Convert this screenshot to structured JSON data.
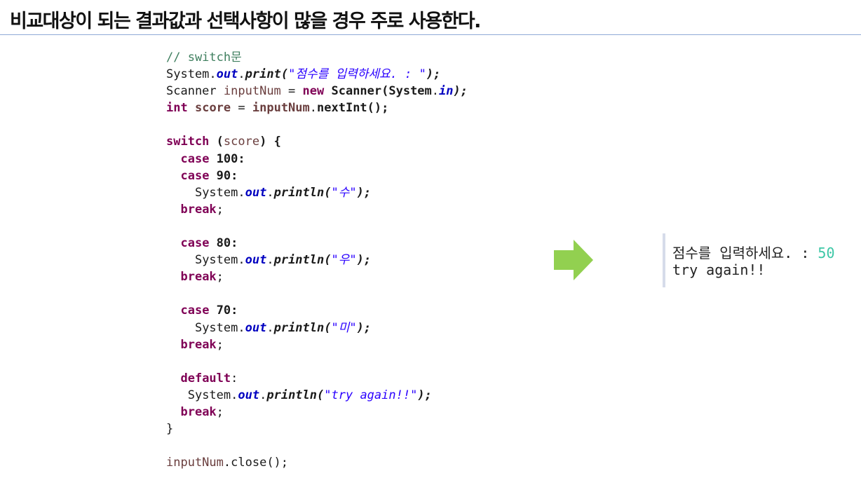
{
  "heading": "비교대상이 되는 결과값과 선택사항이 많을 경우 주로 사용한다.",
  "code": {
    "comment": "// switch문",
    "l2": {
      "cls": "System",
      "dot": ".",
      "fld": "out",
      "dot2": ".",
      "mth": "print",
      "open": "(",
      "str": "\"점수를 입력하세요. : \"",
      "close": ");"
    },
    "l3": {
      "type": "Scanner",
      "var": "inputNum",
      "eq": " = ",
      "kw": "new",
      "ctor": "Scanner(System",
      "dot": ".",
      "fld": "in",
      "close": ");"
    },
    "l4": {
      "kw": "int",
      "var": "score",
      "eq": " = ",
      "var2": "inputNum",
      "dot": ".",
      "call": "nextInt();"
    },
    "l6": {
      "kw": "switch",
      "open": " (",
      "var": "score",
      "close": ") {"
    },
    "c100": {
      "kw": "case",
      "val": " 100:"
    },
    "c90": {
      "kw": "case",
      "val": " 90:"
    },
    "p1": {
      "cls": "System",
      "dot": ".",
      "fld": "out",
      "dot2": ".",
      "mth": "println",
      "open": "(",
      "str": "\"수\"",
      "close": ");"
    },
    "br1": {
      "kw": "break",
      "semi": ";"
    },
    "c80": {
      "kw": "case",
      "val": " 80:"
    },
    "p2": {
      "cls": "System",
      "dot": ".",
      "fld": "out",
      "dot2": ".",
      "mth": "println",
      "open": "(",
      "str": "\"우\"",
      "close": ");"
    },
    "br2": {
      "kw": "break",
      "semi": ";"
    },
    "c70": {
      "kw": "case",
      "val": " 70:"
    },
    "p3": {
      "cls": "System",
      "dot": ".",
      "fld": "out",
      "dot2": ".",
      "mth": "println",
      "open": "(",
      "str": "\"미\"",
      "close": ");"
    },
    "br3": {
      "kw": "break",
      "semi": ";"
    },
    "def": {
      "kw": "default",
      "colon": ":"
    },
    "p4": {
      "cls": "System",
      "dot": ".",
      "fld": "out",
      "dot2": ".",
      "mth": "println",
      "open": "(",
      "str": "\"try again!!\"",
      "close": ");"
    },
    "br4": {
      "kw": "break",
      "semi": ";"
    },
    "end": "}",
    "last": {
      "var": "inputNum",
      "dot": ".",
      "call": "close();"
    }
  },
  "console": {
    "prompt": "점수를 입력하세요. : ",
    "input": "50",
    "output": "try again!!"
  },
  "colors": {
    "keyword": "#7f0055",
    "string": "#2a00ff",
    "comment": "#3f7f5f",
    "arrow": "#92d050",
    "console_input": "#3cc7a6"
  },
  "icons": {
    "arrow": "right-arrow-icon"
  }
}
